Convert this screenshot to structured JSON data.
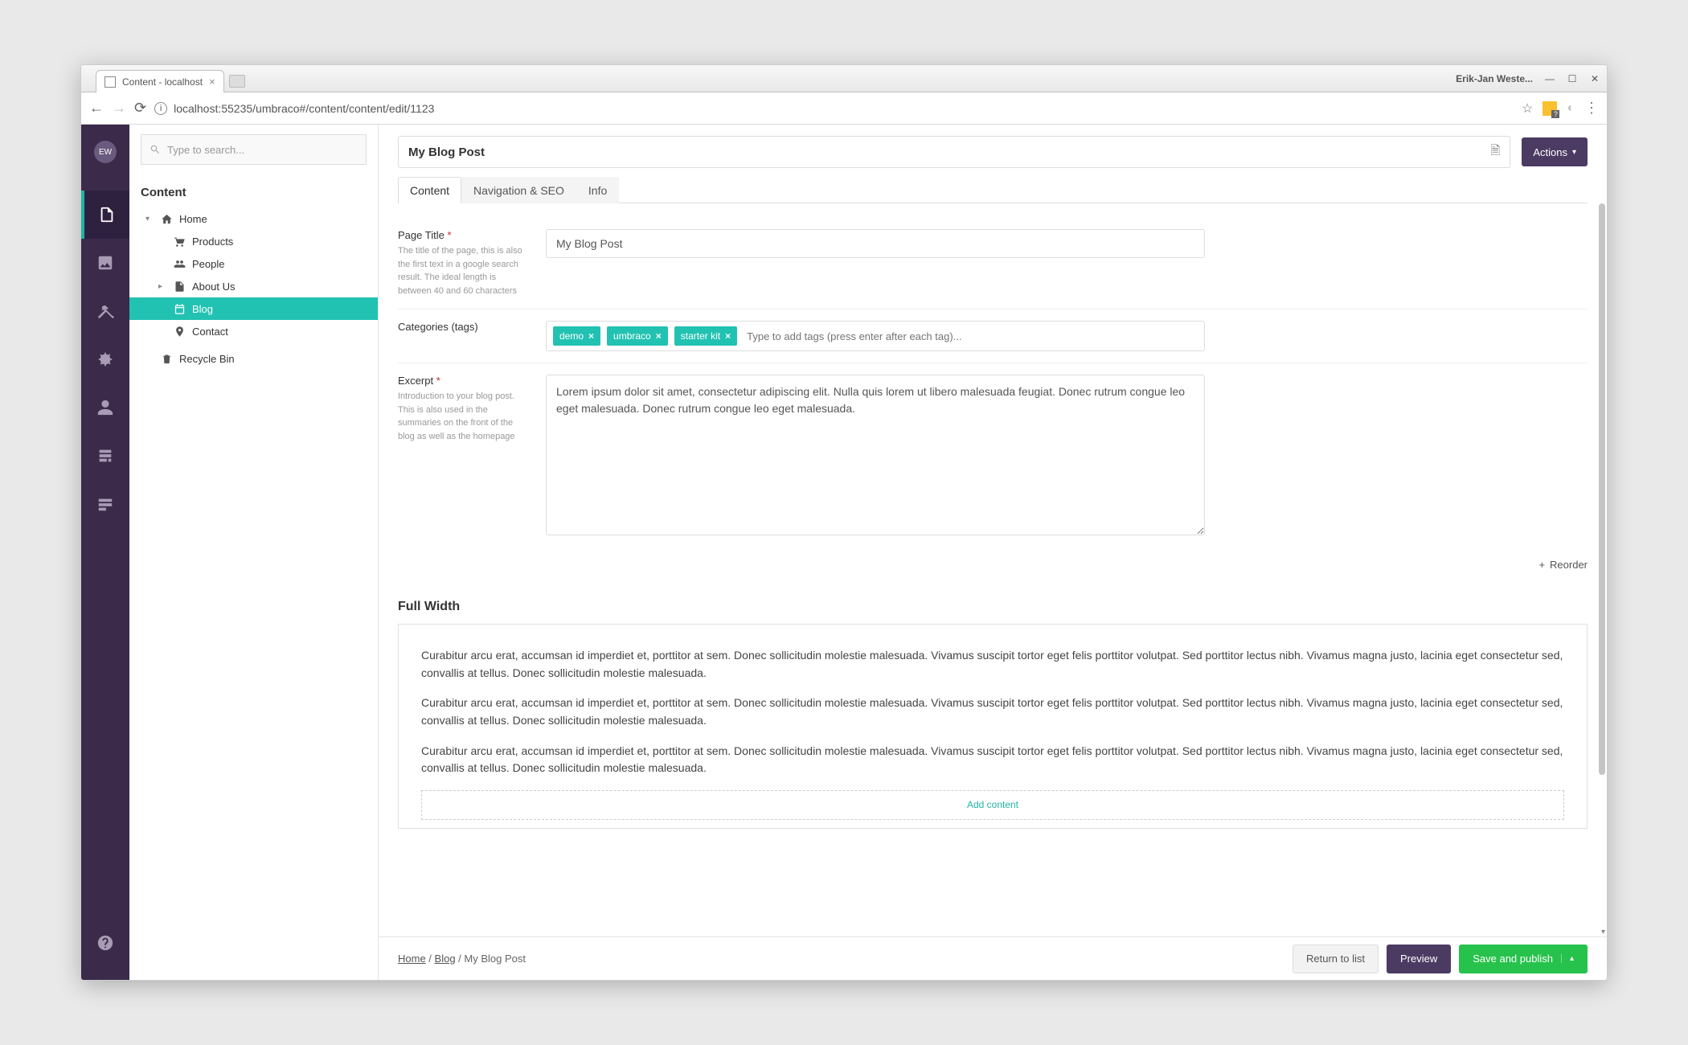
{
  "browser": {
    "tab_title": "Content - localhost",
    "profile": "Erik-Jan Weste...",
    "url": "localhost:55235/umbraco#/content/content/edit/1123"
  },
  "rail": {
    "avatar_initials": "EW"
  },
  "search": {
    "placeholder": "Type to search..."
  },
  "tree": {
    "section": "Content",
    "home": "Home",
    "items": [
      "Products",
      "People",
      "About Us",
      "Blog",
      "Contact"
    ],
    "recycle": "Recycle Bin"
  },
  "header": {
    "title": "My Blog Post",
    "actions": "Actions",
    "tabs": [
      "Content",
      "Navigation & SEO",
      "Info"
    ]
  },
  "props": {
    "page_title": {
      "label": "Page Title",
      "desc": "The title of the page, this is also the first text in a google search result. The ideal length is between 40 and 60 characters",
      "value": "My Blog Post"
    },
    "categories": {
      "label": "Categories (tags)",
      "tags": [
        "demo",
        "umbraco",
        "starter kit"
      ],
      "placeholder": "Type to add tags (press enter after each tag)..."
    },
    "excerpt": {
      "label": "Excerpt",
      "desc": "Introduction to your blog post. This is also used in the summaries on the front of the blog as well as the homepage",
      "value": "Lorem ipsum dolor sit amet, consectetur adipiscing elit. Nulla quis lorem ut libero malesuada feugiat. Donec rutrum congue leo eget malesuada. Donec rutrum congue leo eget malesuada."
    }
  },
  "reorder": "Reorder",
  "grid": {
    "title": "Full Width",
    "paragraph": "Curabitur arcu erat, accumsan id imperdiet et, porttitor at sem. Donec sollicitudin molestie malesuada. Vivamus suscipit tortor eget felis porttitor volutpat. Sed porttitor lectus nibh. Vivamus magna justo, lacinia eget consectetur sed, convallis at tellus. Donec sollicitudin molestie malesuada.",
    "add": "Add content"
  },
  "footer": {
    "crumbs": [
      "Home",
      "Blog",
      "My Blog Post"
    ],
    "return": "Return to list",
    "preview": "Preview",
    "publish": "Save and publish"
  }
}
